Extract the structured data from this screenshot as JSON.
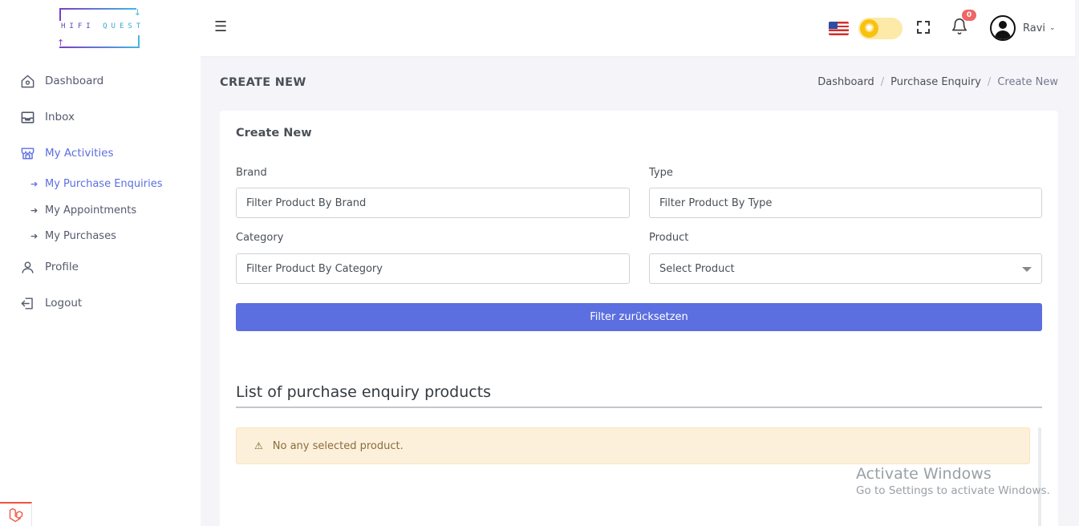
{
  "brand": {
    "logo_text_left": "HIFI",
    "logo_text_right": "QUEST"
  },
  "header": {
    "notification_count": "0",
    "user_name": "Ravi"
  },
  "sidebar": {
    "items": [
      {
        "label": "Dashboard",
        "icon": "home-icon"
      },
      {
        "label": "Inbox",
        "icon": "inbox-icon"
      },
      {
        "label": "My Activities",
        "icon": "store-icon"
      },
      {
        "label": "Profile",
        "icon": "user-icon"
      },
      {
        "label": "Logout",
        "icon": "logout-icon"
      }
    ],
    "sub_items": [
      {
        "label": "My Purchase Enquiries"
      },
      {
        "label": "My Appointments"
      },
      {
        "label": "My Purchases"
      }
    ]
  },
  "page": {
    "title": "CREATE NEW",
    "breadcrumb": [
      "Dashboard",
      "Purchase Enquiry",
      "Create New"
    ]
  },
  "form": {
    "card_title": "Create New",
    "brand_label": "Brand",
    "brand_placeholder": "Filter Product By Brand",
    "type_label": "Type",
    "type_placeholder": "Filter Product By Type",
    "category_label": "Category",
    "category_placeholder": "Filter Product By Category",
    "product_label": "Product",
    "product_selected": "Select Product",
    "reset_button": "Filter zurücksetzen"
  },
  "list": {
    "title": "List of purchase enquiry products",
    "empty_message": "No any selected product."
  },
  "watermark": {
    "line1": "Activate Windows",
    "line2": "Go to Settings to activate Windows."
  },
  "colors": {
    "primary": "#5b6fe0",
    "badge": "#f06565",
    "alert_bg": "#fcf0db",
    "toggle_bg": "#fde9a8",
    "toggle_knob": "#f8c20d"
  }
}
